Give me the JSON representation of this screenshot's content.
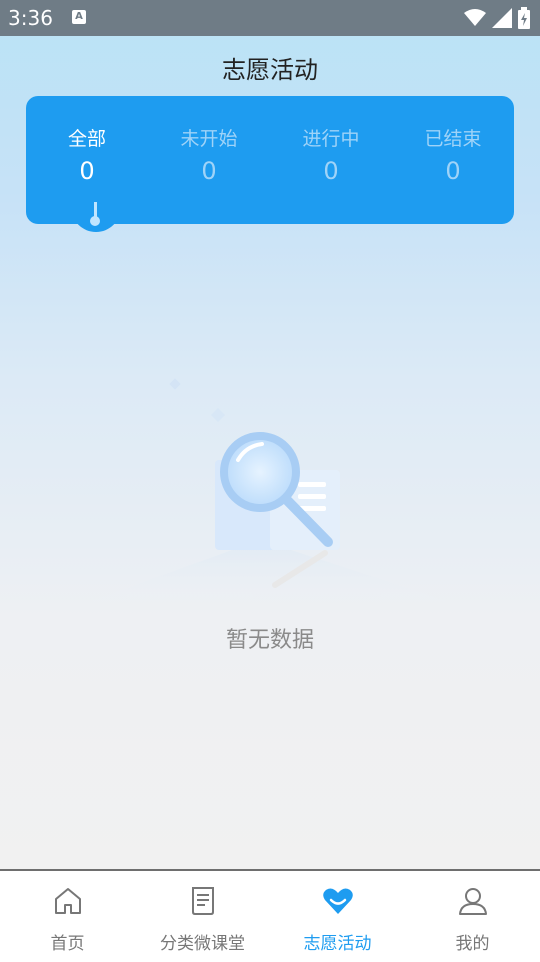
{
  "status_bar": {
    "time": "3:36",
    "notification_icon": "a-icon",
    "icons": [
      "wifi-icon",
      "signal-icon",
      "battery-charging-icon"
    ]
  },
  "page": {
    "title": "志愿活动"
  },
  "tabs": [
    {
      "label": "全部",
      "count": "0",
      "active": true
    },
    {
      "label": "未开始",
      "count": "0",
      "active": false
    },
    {
      "label": "进行中",
      "count": "0",
      "active": false
    },
    {
      "label": "已结束",
      "count": "0",
      "active": false
    }
  ],
  "empty_state": {
    "icon": "magnifier-document-icon",
    "text": "暂无数据"
  },
  "bottom_nav": {
    "items": [
      {
        "label": "首页",
        "icon": "home-icon",
        "active": false
      },
      {
        "label": "分类微课堂",
        "icon": "document-list-icon",
        "active": false
      },
      {
        "label": "志愿活动",
        "icon": "heart-icon",
        "active": true
      },
      {
        "label": "我的",
        "icon": "user-icon",
        "active": false
      }
    ]
  },
  "colors": {
    "accent": "#1e9cf0",
    "tab_inactive_text": "#9fd3f8",
    "status_bar": "#6f7c86"
  }
}
